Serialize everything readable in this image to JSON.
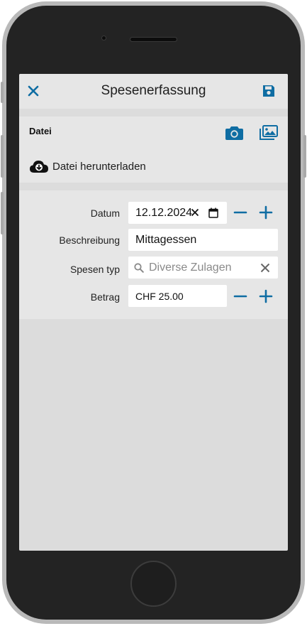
{
  "header": {
    "title": "Spesenerfassung",
    "close_icon": "close-icon",
    "save_icon": "floppy-disk-icon"
  },
  "file_section": {
    "title": "Datei",
    "camera_icon": "camera-icon",
    "gallery_icon": "images-icon",
    "download_label": "Datei herunterladen",
    "download_icon": "cloud-download-icon"
  },
  "form": {
    "date": {
      "label": "Datum",
      "value": "12.12.2024"
    },
    "description": {
      "label": "Beschreibung",
      "value": "Mittagessen"
    },
    "expense_type": {
      "label": "Spesen typ",
      "placeholder": "Diverse Zulagen"
    },
    "amount": {
      "label": "Betrag",
      "value": "CHF 25.00"
    }
  },
  "colors": {
    "accent": "#0f6da3",
    "panel": "#e6e6e6",
    "background": "#dcdcdc"
  }
}
